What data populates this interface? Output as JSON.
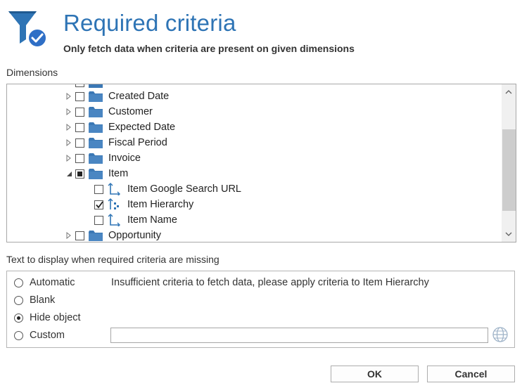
{
  "header": {
    "title": "Required criteria",
    "subtitle": "Only fetch data when criteria are present on given dimensions",
    "icon": "filter-check-icon"
  },
  "dimensions": {
    "label": "Dimensions",
    "rows": [
      {
        "label": "Created Date",
        "type": "folder",
        "checked": false
      },
      {
        "label": "Customer",
        "type": "folder",
        "checked": false
      },
      {
        "label": "Expected Date",
        "type": "folder",
        "checked": false
      },
      {
        "label": "Fiscal Period",
        "type": "folder",
        "checked": false
      },
      {
        "label": "Invoice",
        "type": "folder",
        "checked": false
      },
      {
        "label": "Item",
        "type": "folder",
        "state": "partial",
        "expanded": true
      },
      {
        "label": "Item Google Search URL",
        "type": "attribute",
        "checked": false
      },
      {
        "label": "Item Hierarchy",
        "type": "hierarchy",
        "checked": true
      },
      {
        "label": "Item Name",
        "type": "attribute",
        "checked": false
      },
      {
        "label": "Opportunity",
        "type": "folder",
        "checked": false
      }
    ]
  },
  "missing": {
    "label": "Text to display when required criteria are missing",
    "options": [
      {
        "label": "Automatic",
        "selected": false
      },
      {
        "label": "Blank",
        "selected": false
      },
      {
        "label": "Hide object",
        "selected": true
      },
      {
        "label": "Custom",
        "selected": false
      }
    ],
    "automatic_message": "Insufficient criteria to fetch data, please apply criteria to Item Hierarchy",
    "custom_value": ""
  },
  "buttons": {
    "ok": "OK",
    "cancel": "Cancel"
  },
  "colors": {
    "accent": "#2e74b5",
    "folder": "#3b78b5",
    "check_badge": "#2f6fc6"
  }
}
